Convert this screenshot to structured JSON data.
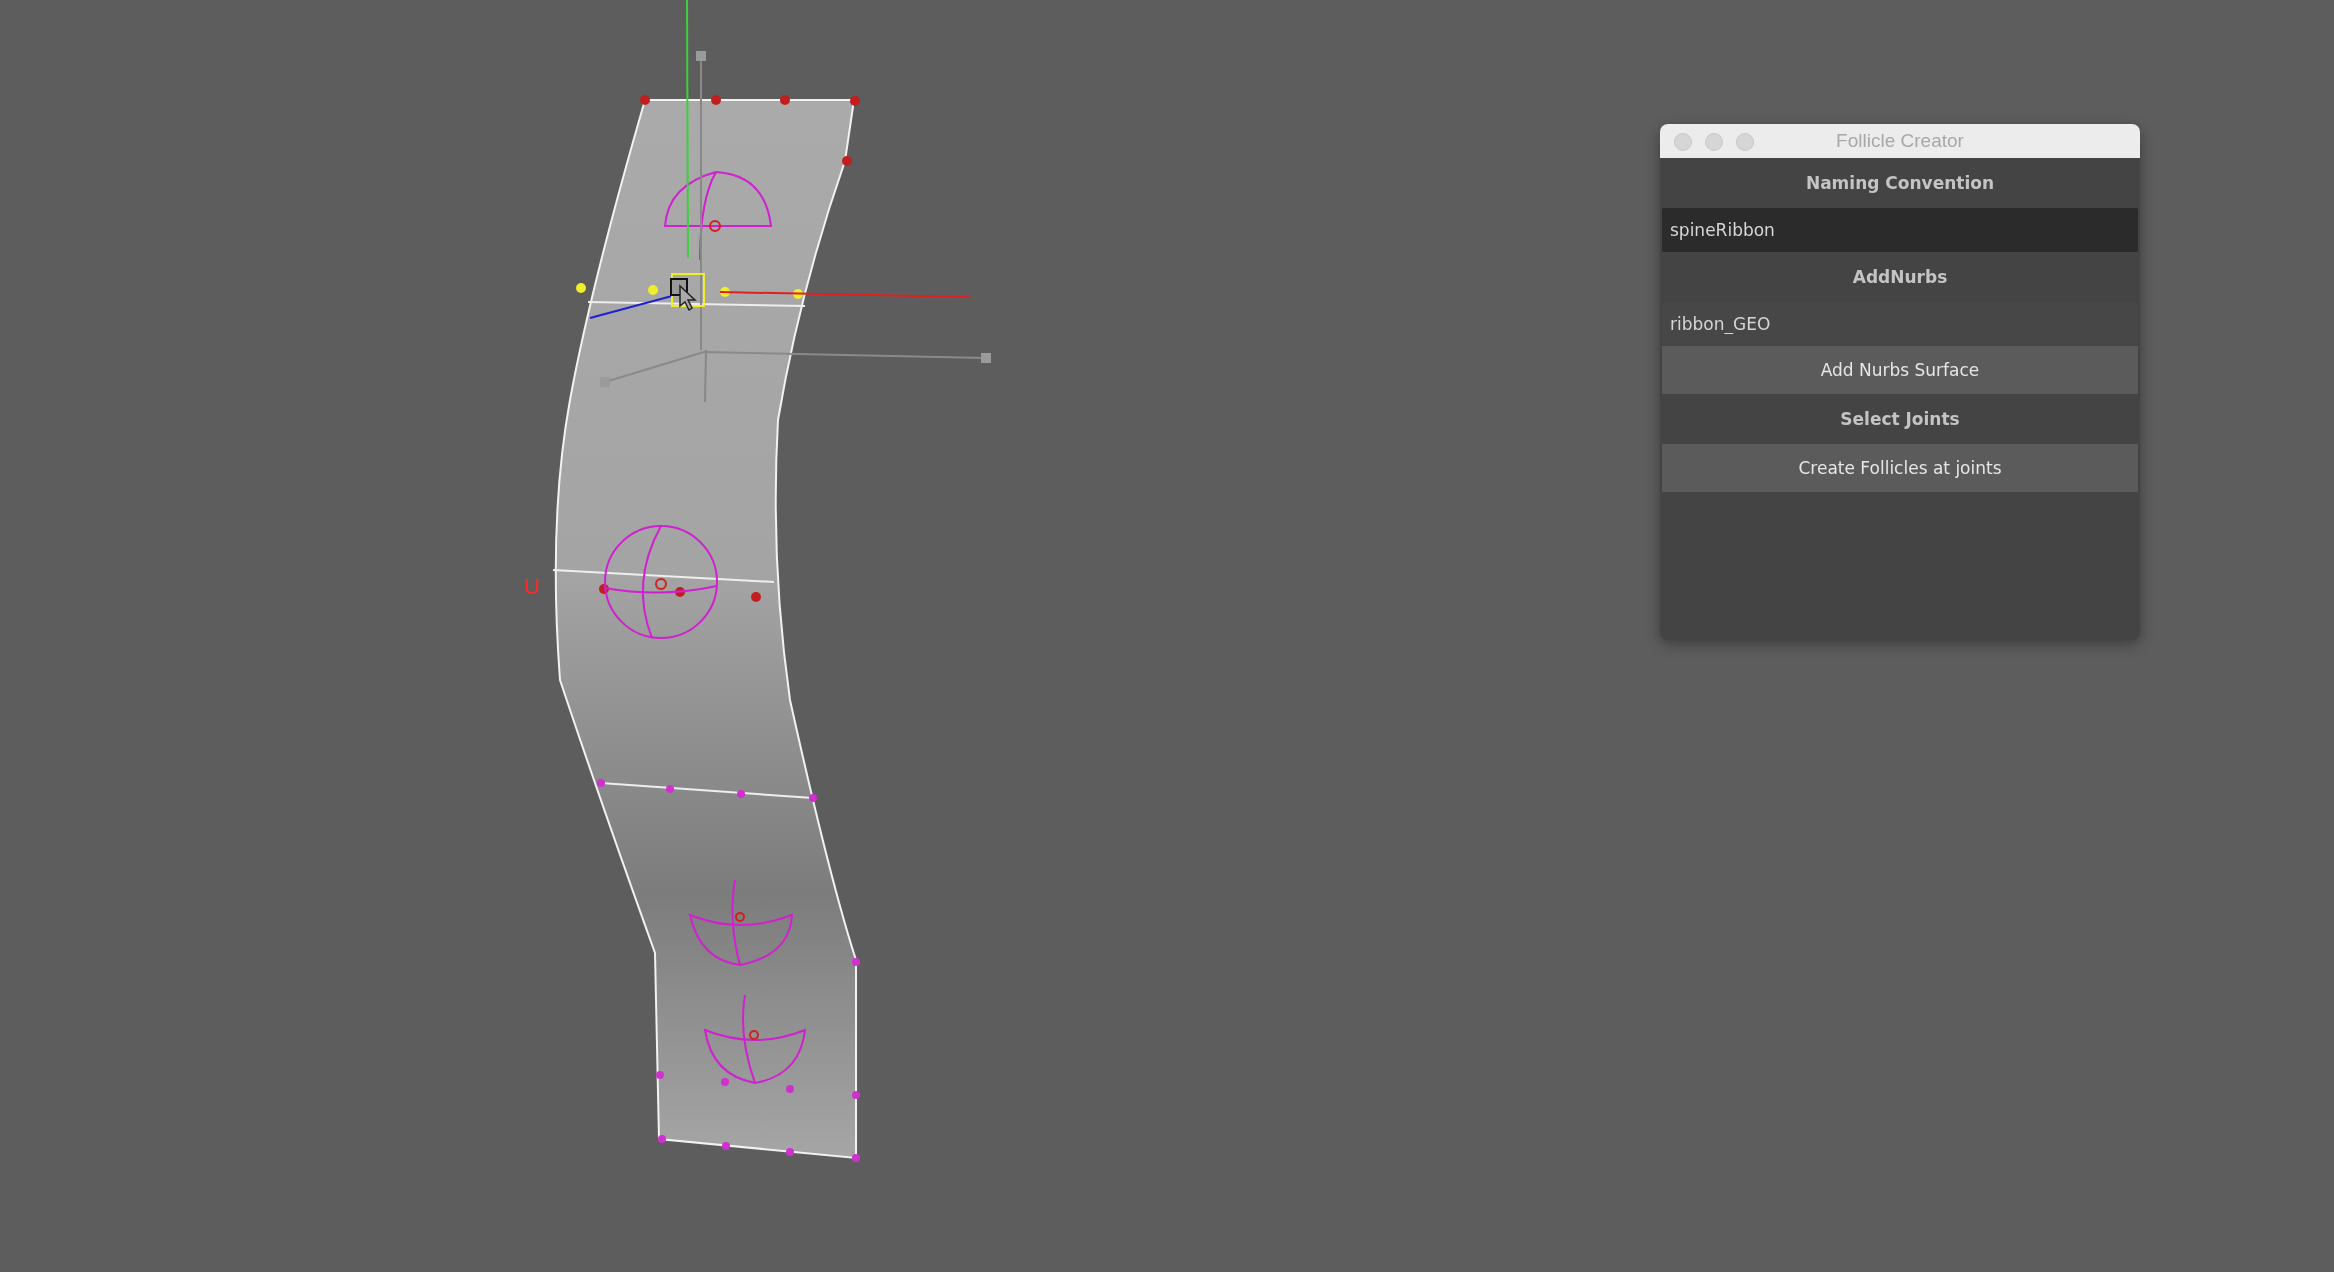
{
  "viewport": {
    "axis_label": "U"
  },
  "window": {
    "title": "Follicle Creator",
    "controls": [
      {
        "kind": "header",
        "label": "Naming Convention"
      },
      {
        "kind": "field",
        "value": "spineRibbon",
        "focused": true
      },
      {
        "kind": "header",
        "label": "AddNurbs"
      },
      {
        "kind": "field",
        "value": "ribbon_GEO",
        "focused": false
      },
      {
        "kind": "button",
        "label": "Add Nurbs Surface"
      },
      {
        "kind": "header",
        "label": "Select Joints"
      },
      {
        "kind": "button",
        "label": "Create Follicles at joints"
      }
    ]
  }
}
